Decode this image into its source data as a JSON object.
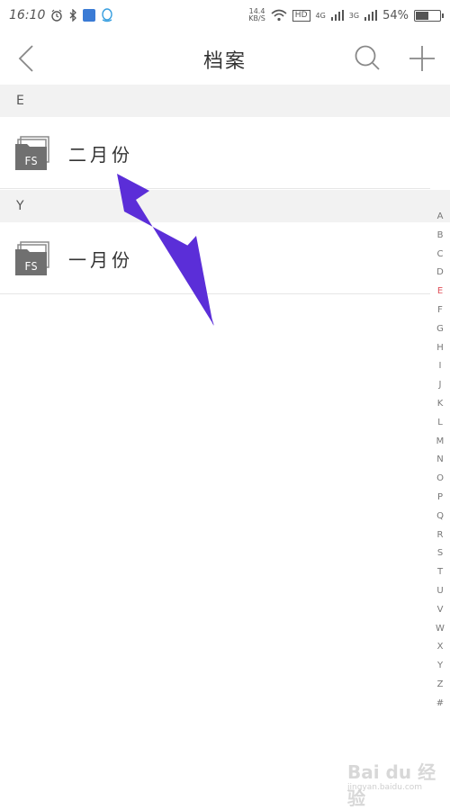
{
  "status_bar": {
    "time": "16:10",
    "speed_value": "14.4",
    "speed_unit": "KB/S",
    "hd": "HD",
    "net1": "4G",
    "net2": "3G",
    "battery": "54%",
    "battery_level": 0.54
  },
  "header": {
    "title": "档案"
  },
  "sections": [
    {
      "letter": "E",
      "items": [
        {
          "label": "二月份",
          "icon_text": "FS"
        }
      ]
    },
    {
      "letter": "Y",
      "items": [
        {
          "label": "一月份",
          "icon_text": "FS"
        }
      ]
    }
  ],
  "alphabet": [
    "A",
    "B",
    "C",
    "D",
    "E",
    "F",
    "G",
    "H",
    "I",
    "J",
    "K",
    "L",
    "M",
    "N",
    "O",
    "P",
    "Q",
    "R",
    "S",
    "T",
    "U",
    "V",
    "W",
    "X",
    "Y",
    "Z",
    "#"
  ],
  "alphabet_active": "E",
  "colors": {
    "arrow": "#5b2ed8",
    "active_letter": "#e0505a",
    "section_bg": "#f2f2f2",
    "folder_icon": "#707070"
  },
  "watermark": {
    "text": "Bai du 经验",
    "url": "jingyan.baidu.com"
  }
}
